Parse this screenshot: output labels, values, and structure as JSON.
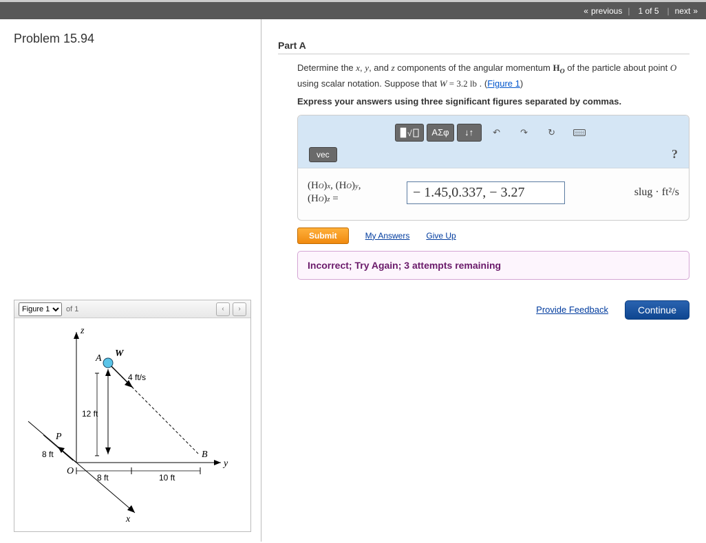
{
  "topbar": {
    "previous": "previous",
    "counter": "1 of 5",
    "next": "next"
  },
  "problem": {
    "title": "Problem 15.94"
  },
  "figure": {
    "select_label": "Figure 1",
    "of_count": "of 1",
    "labels": {
      "z": "z",
      "y": "y",
      "x": "x",
      "A": "A",
      "W": "W",
      "P": "P",
      "B": "B",
      "O": "O",
      "v": "4 ft/s",
      "h12": "12 ft",
      "d8a": "8 ft",
      "d8b": "8 ft",
      "d10": "10 ft"
    }
  },
  "part": {
    "header": "Part A",
    "text_prefix": "Determine the ",
    "text_xyz_sep1": ", ",
    "text_xyz_sep2": ", and ",
    "text_mid": " components of the angular momentum ",
    "H_label": "H",
    "O_sub": "O",
    "text_after_H": " of the particle about point ",
    "O_label": "O",
    "text_after_O": " using scalar notation. Suppose that ",
    "W_label": "W",
    "W_eq": " = 3.2 ",
    "lb": "lb",
    "dot_space": " . (",
    "figure_link": "Figure 1",
    "close_paren": ")",
    "instruct": "Express your answers using three significant figures separated by commas.",
    "vars": {
      "x": "x",
      "y": "y",
      "z": "z"
    }
  },
  "toolbar": {
    "templates_alt": "templates",
    "greek": "ΑΣφ",
    "updown": "↓↑",
    "undo": "↶",
    "redo": "↷",
    "reset": "↻",
    "keyboard": "keyboard",
    "vec": "vec",
    "help": "?"
  },
  "answer": {
    "lhs_line1_a": "(H",
    "lhs_line1_b": ")",
    "comma": ", ",
    "eq": " =",
    "value": "− 1.45,0.337, − 3.27",
    "units": "slug · ft²/s",
    "subs": {
      "O": "O",
      "x": "x",
      "y": "y",
      "z": "z"
    }
  },
  "actions": {
    "submit": "Submit",
    "my_answers": "My Answers",
    "give_up": "Give Up",
    "feedback_msg": "Incorrect; Try Again; 3 attempts remaining",
    "provide_feedback": "Provide Feedback",
    "continue": "Continue"
  }
}
